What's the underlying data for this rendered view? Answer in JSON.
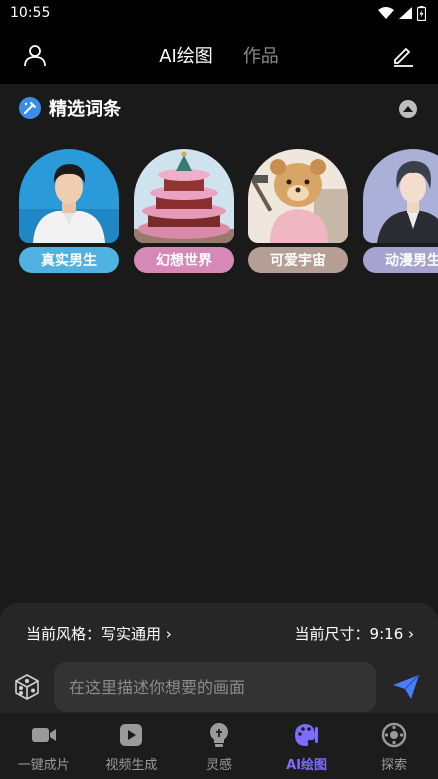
{
  "status_bar": {
    "time": "10:55"
  },
  "top_nav": {
    "tabs": [
      {
        "label": "AI绘图",
        "active": true
      },
      {
        "label": "作品",
        "active": false
      }
    ]
  },
  "section": {
    "title": "精选词条"
  },
  "cards": [
    {
      "label": "真实男生",
      "color": "#4fb2e0"
    },
    {
      "label": "幻想世界",
      "color": "#d689b6"
    },
    {
      "label": "可爱宇宙",
      "color": "#b59f95"
    },
    {
      "label": "动漫男生",
      "color": "#a7a3cf"
    }
  ],
  "bottom_panel": {
    "style_label": "当前风格：写实通用 ›",
    "size_label": "当前尺寸：9:16 ›",
    "prompt_placeholder": "在这里描述你想要的画面",
    "send_color": "#4a7cf5"
  },
  "tab_bar": {
    "items": [
      {
        "label": "一键成片",
        "icon": "video-camera-icon",
        "active": false
      },
      {
        "label": "视频生成",
        "icon": "play-square-icon",
        "active": false
      },
      {
        "label": "灵感",
        "icon": "lightbulb-icon",
        "active": false
      },
      {
        "label": "AI绘图",
        "icon": "palette-icon",
        "active": true
      },
      {
        "label": "探索",
        "icon": "explore-icon",
        "active": false
      }
    ],
    "active_color": "#7c6cff"
  }
}
